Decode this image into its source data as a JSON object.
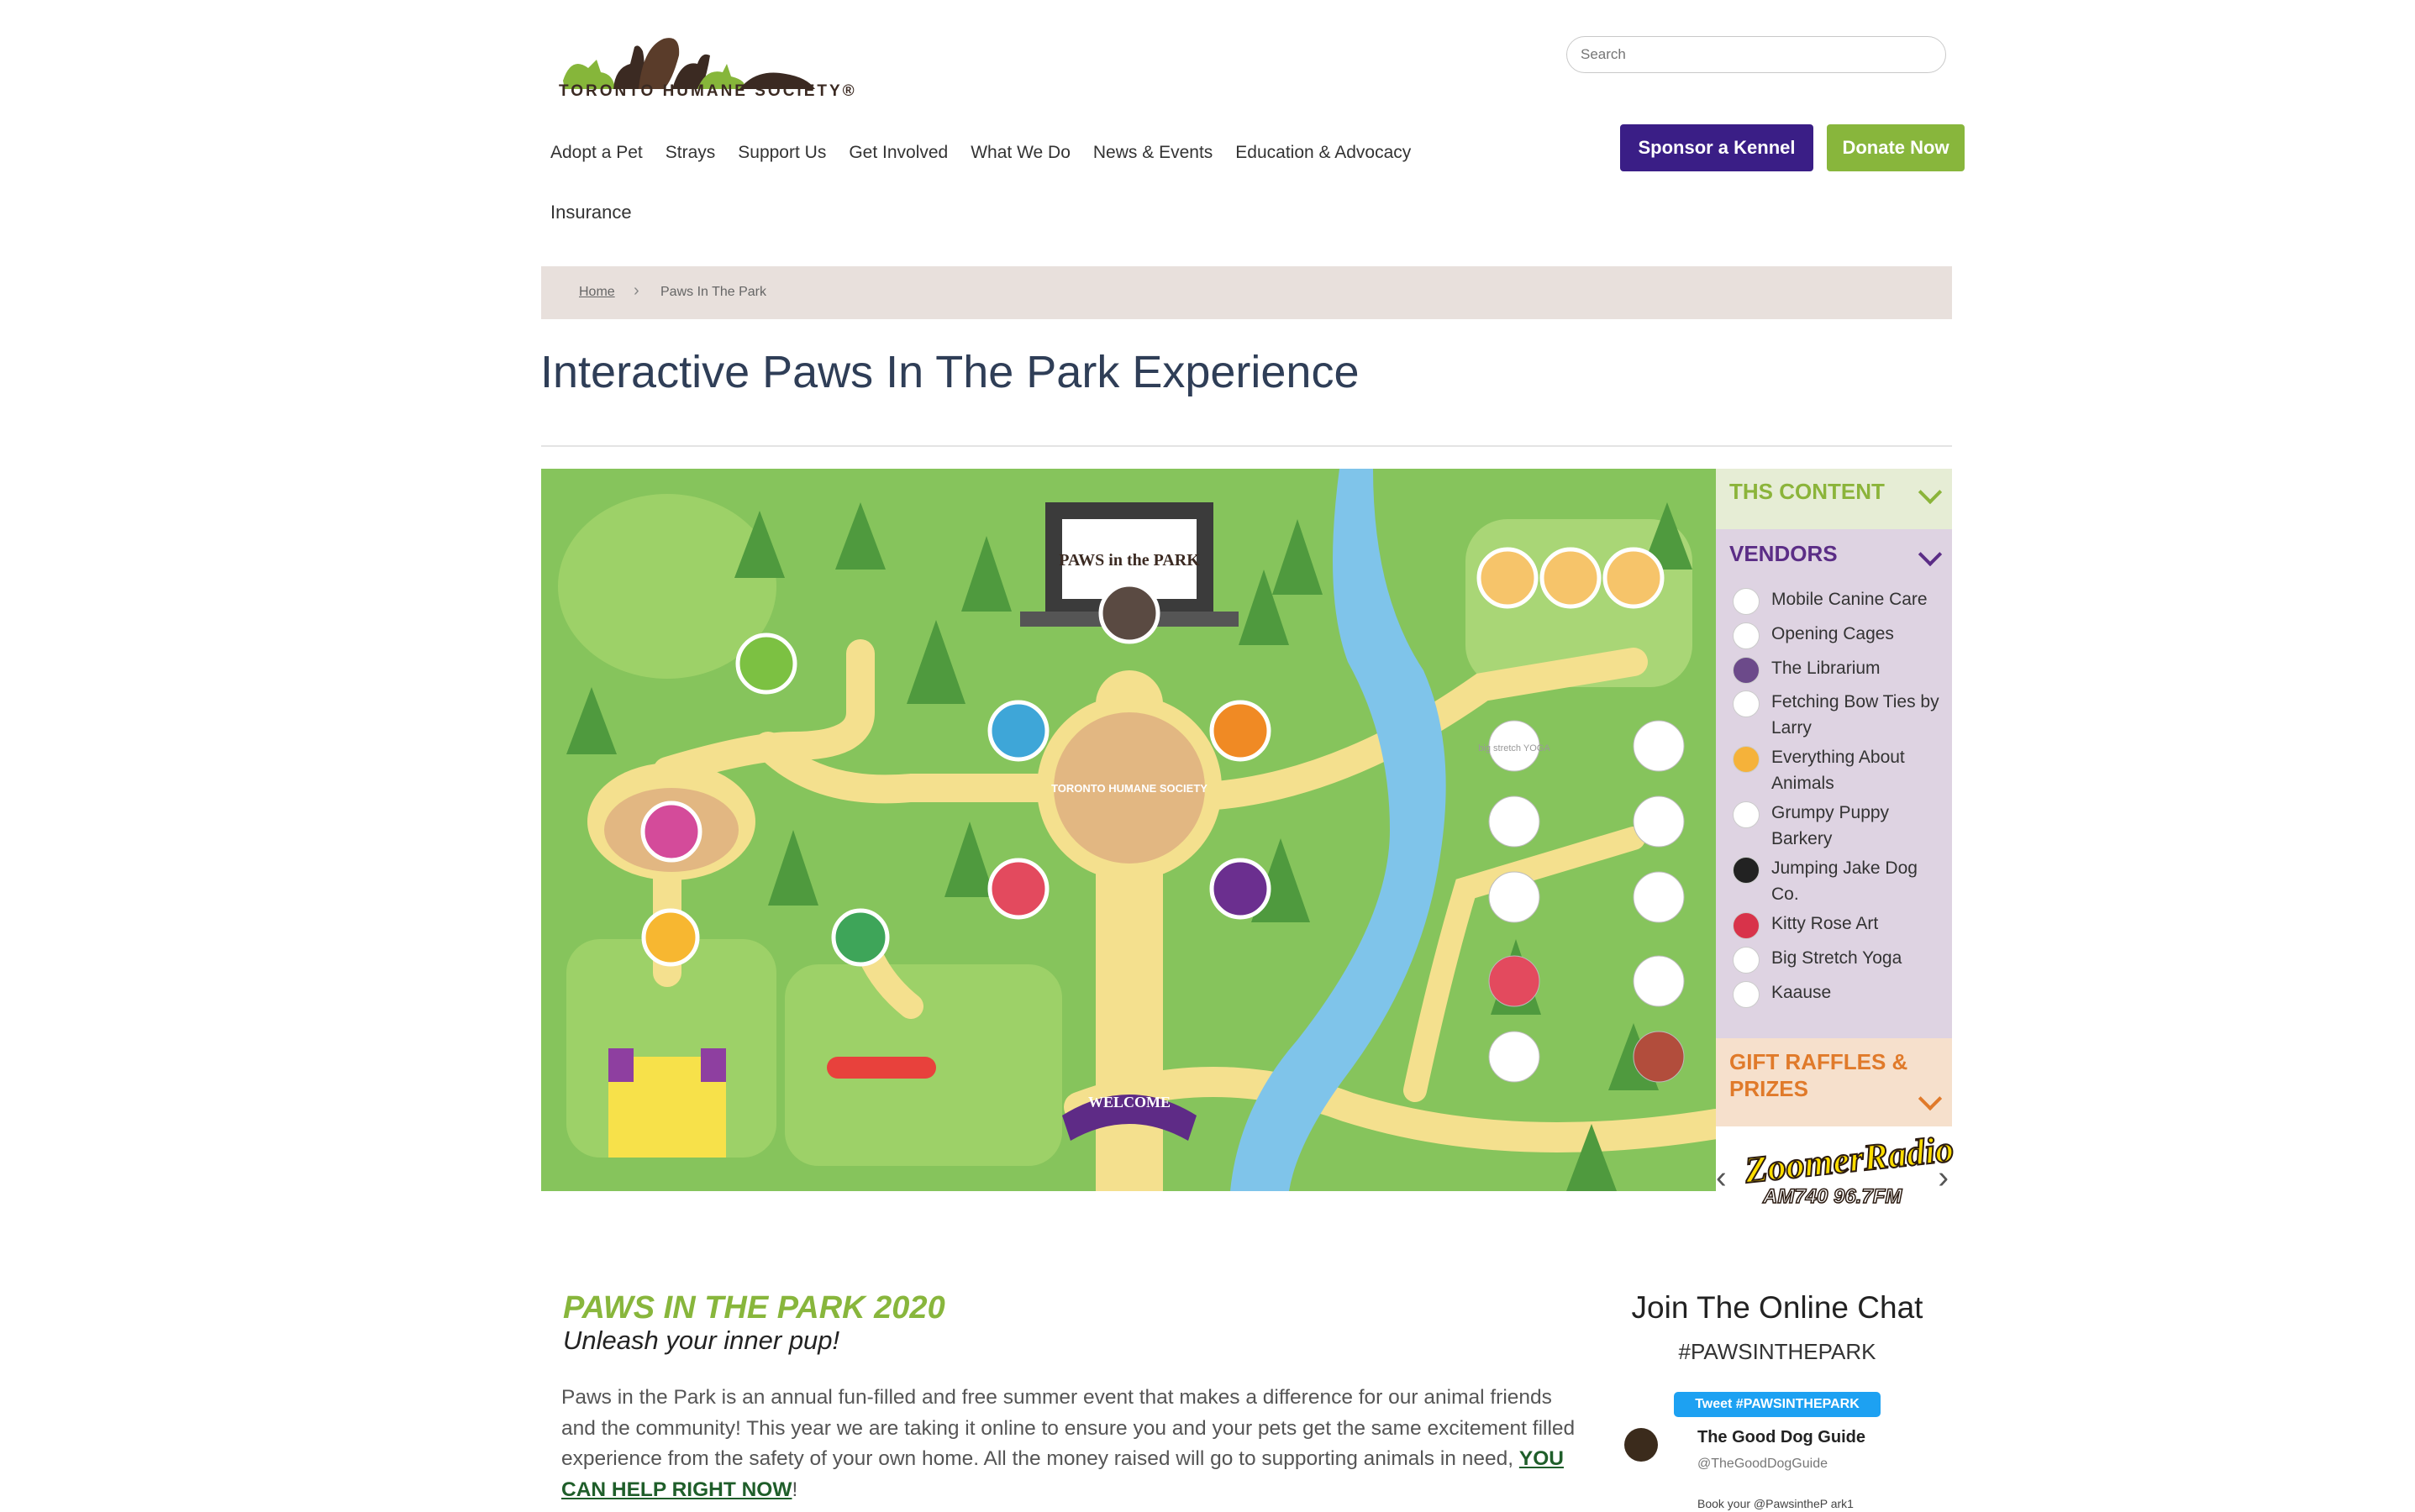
{
  "header": {
    "logo_text": "TORONTO HUMANE SOCIETY®",
    "search_placeholder": "Search",
    "nav": [
      "Adopt a Pet",
      "Strays",
      "Support Us",
      "Get Involved",
      "What We Do",
      "News & Events",
      "Education & Advocacy"
    ],
    "nav_row2": "Insurance",
    "sponsor_label": "Sponsor a Kennel",
    "donate_label": "Donate Now"
  },
  "breadcrumb": {
    "home": "Home",
    "current": "Paws In The Park"
  },
  "page_title": "Interactive Paws In The Park Experience",
  "map": {
    "stage_text": "PAWS in the PARK",
    "center_text": "TORONTO HUMANE SOCIETY",
    "welcome_text": "WELCOME",
    "vendor_yoga_text": "big stretch YOGA"
  },
  "side_panel": {
    "ths_content": "THS CONTENT",
    "vendors_title": "VENDORS",
    "vendors": [
      "Mobile Canine Care",
      "Opening Cages",
      "The Librarium",
      "Fetching Bow Ties by Larry",
      "Everything About Animals",
      "Grumpy Puppy Barkery",
      "Jumping Jake Dog Co.",
      "Kitty Rose Art",
      "Big Stretch Yoga",
      "Kaause"
    ],
    "gift_title": "GIFT RAFFLES & PRIZES",
    "sponsor_logo": "ZoomerRadio",
    "sponsor_freq": "AM740 96.7FM"
  },
  "content": {
    "heading": "PAWS IN THE PARK 2020",
    "subheading": "Unleash your inner pup!",
    "paragraph": "Paws in the Park is an annual fun-filled and free summer event that makes a difference for our animal friends and the community! This year we are taking it online to ensure you and your pets get the same excitement filled experience from the safety of your own home. All the money raised will go to supporting animals in need,",
    "cta_link": "YOU CAN HELP RIGHT NOW",
    "cta_after": "!"
  },
  "chat": {
    "title": "Join The Online Chat",
    "hashtag": "#PAWSINTHEPARK",
    "tweet_button": "Tweet #PAWSINTHEPARK",
    "tweet_name": "The Good Dog Guide",
    "tweet_handle": "@TheGoodDogGuide",
    "tweet_text": "Book your @PawsintheP ark1"
  },
  "colors": {
    "sponsor": "#3a1e86",
    "donate": "#88b63c",
    "title": "#2f3e57",
    "ths": "#8bb43a",
    "vendors": "#5b2d86",
    "gift": "#e07a2a"
  }
}
